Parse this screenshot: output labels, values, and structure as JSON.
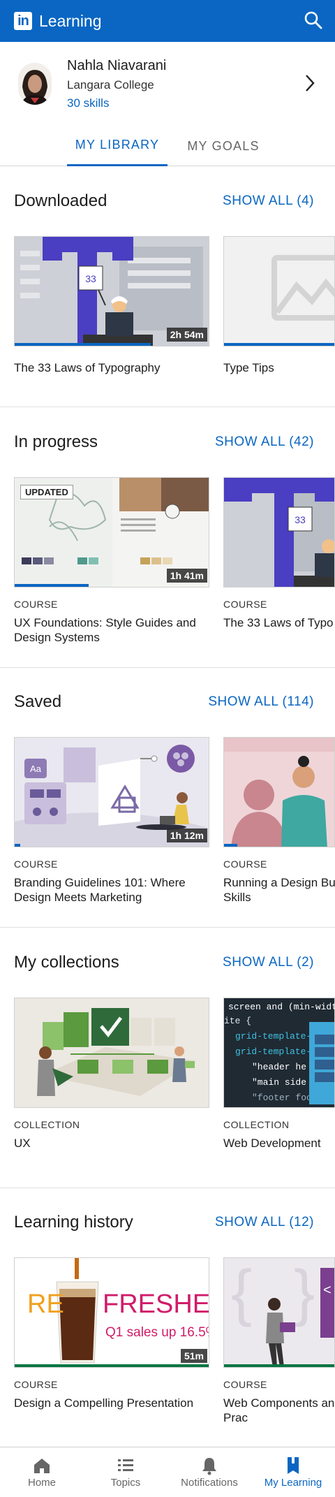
{
  "app": {
    "title": "Learning"
  },
  "profile": {
    "name": "Nahla Niavarani",
    "college": "Langara College",
    "skills": "30 skills"
  },
  "tabs": [
    {
      "label": "MY LIBRARY",
      "active": true
    },
    {
      "label": "MY GOALS",
      "active": false
    }
  ],
  "sections": {
    "downloaded": {
      "title": "Downloaded",
      "show_all": "SHOW ALL (4)",
      "items": [
        {
          "title": "The 33 Laws of Typography",
          "duration": "2h 54m"
        },
        {
          "title": "Type Tips"
        }
      ]
    },
    "in_progress": {
      "title": "In progress",
      "show_all": "SHOW ALL (42)",
      "items": [
        {
          "type": "COURSE",
          "title": "UX Foundations: Style Guides and Design Systems",
          "duration": "1h 41m",
          "badge": "UPDATED",
          "progress": 0.38
        },
        {
          "type": "COURSE",
          "title": "The 33 Laws of Typo"
        }
      ]
    },
    "saved": {
      "title": "Saved",
      "show_all": "SHOW ALL (114)",
      "items": [
        {
          "type": "COURSE",
          "title": "Branding Guidelines 101: Where Design Meets Marketing",
          "duration": "1h 12m"
        },
        {
          "type": "COURSE",
          "title": "Running a Design Bu Presentation Skills"
        }
      ]
    },
    "collections": {
      "title": "My collections",
      "show_all": "SHOW ALL (2)",
      "items": [
        {
          "type": "COLLECTION",
          "title": "UX"
        },
        {
          "type": "COLLECTION",
          "title": "Web Development"
        }
      ]
    },
    "history": {
      "title": "Learning history",
      "show_all": "SHOW ALL (12)",
      "items": [
        {
          "type": "COURSE",
          "title": "Design a Compelling Presentation",
          "duration": "51m"
        },
        {
          "type": "COURSE",
          "title": "Web Components an Modularization: Prac"
        }
      ]
    }
  },
  "code_thumb": {
    "lines": [
      "screen and (min-widt",
      "ite {",
      "  grid-template-",
      "  grid-template-",
      "    \"header he",
      "    \"main side",
      "    \"footer footer"
    ]
  },
  "refreshed_thumb": {
    "line1": "RE",
    "line2": "FRESHED!",
    "line3": "Q1 sales up 16.5%"
  },
  "typography_thumb": {
    "number": "33"
  },
  "nav": [
    {
      "label": "Home",
      "icon": "home-icon"
    },
    {
      "label": "Topics",
      "icon": "topics-icon"
    },
    {
      "label": "Notifications",
      "icon": "bell-icon"
    },
    {
      "label": "My Learning",
      "icon": "bookmark-icon",
      "active": true
    }
  ],
  "colors": {
    "brand": "#0a66c2",
    "complete": "#057642"
  }
}
